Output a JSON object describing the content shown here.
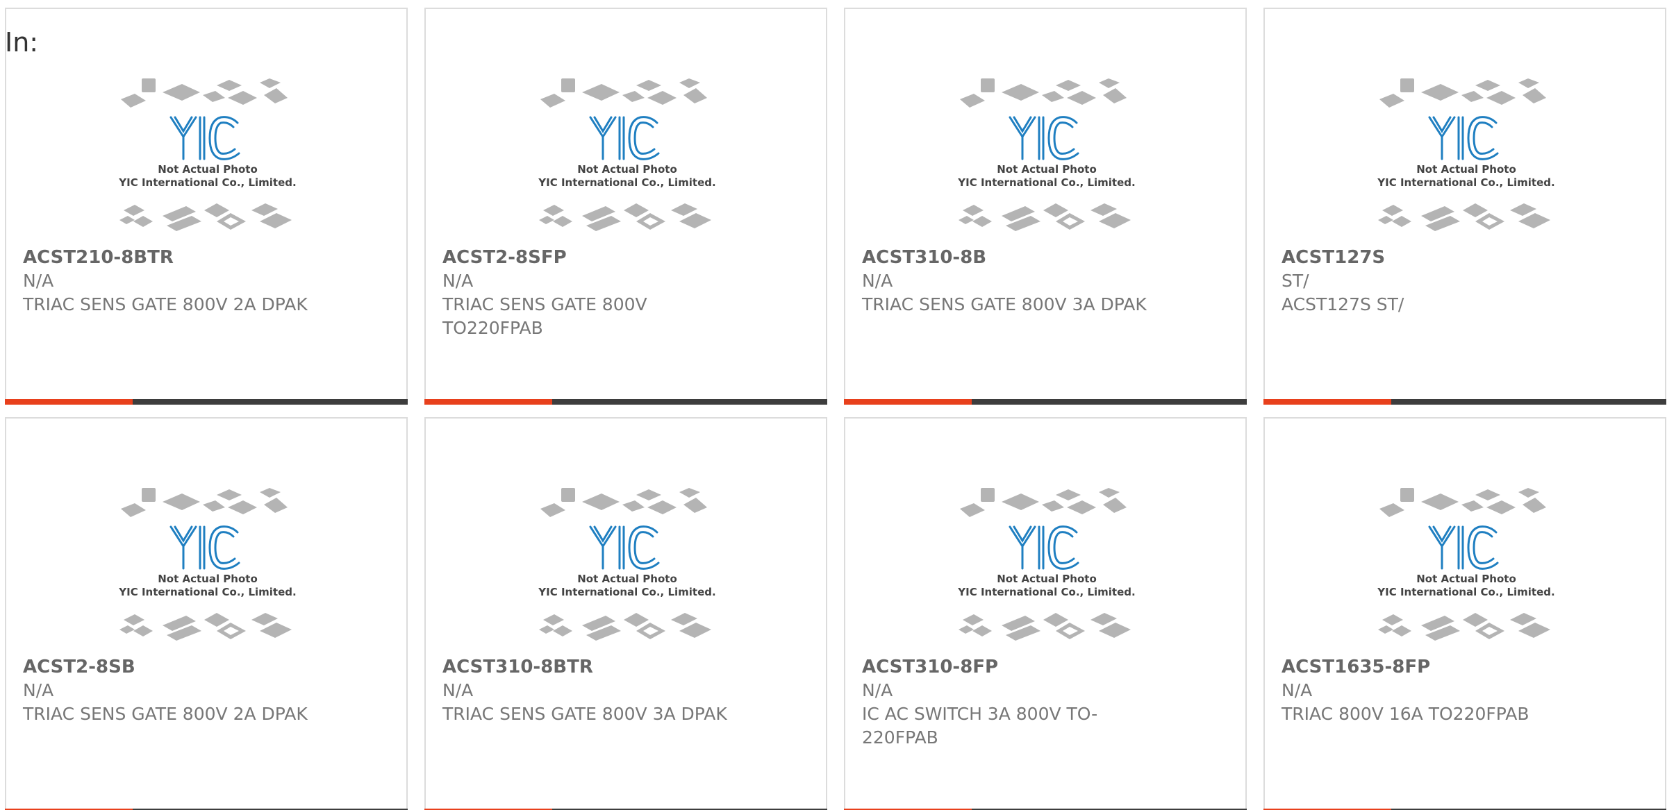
{
  "header": {
    "label": "In:"
  },
  "colors": {
    "accent": "#e8401c",
    "bar_dark": "#3d3d3d",
    "logo_blue": "#1f7fc1",
    "chip_gray": "#b4b4b4"
  },
  "placeholder_image": {
    "line1": "Not Actual Photo",
    "line2": "YIC International Co., Limited.",
    "logo_text": "YIC"
  },
  "products": [
    {
      "part_number": "ACST210-8BTR",
      "manufacturer": "N/A",
      "description": "TRIAC SENS GATE 800V 2A DPAK"
    },
    {
      "part_number": "ACST2-8SFP",
      "manufacturer": "N/A",
      "description": "TRIAC SENS GATE 800V TO220FPAB"
    },
    {
      "part_number": "ACST310-8B",
      "manufacturer": "N/A",
      "description": "TRIAC SENS GATE 800V 3A DPAK"
    },
    {
      "part_number": "ACST127S",
      "manufacturer": "ST/",
      "description": "ACST127S ST/"
    },
    {
      "part_number": "ACST2-8SB",
      "manufacturer": "N/A",
      "description": "TRIAC SENS GATE 800V 2A DPAK"
    },
    {
      "part_number": "ACST310-8BTR",
      "manufacturer": "N/A",
      "description": "TRIAC SENS GATE 800V 3A DPAK"
    },
    {
      "part_number": "ACST310-8FP",
      "manufacturer": "N/A",
      "description": "IC AC SWITCH 3A 800V TO-220FPAB"
    },
    {
      "part_number": "ACST1635-8FP",
      "manufacturer": "N/A",
      "description": "TRIAC 800V 16A TO220FPAB"
    }
  ]
}
